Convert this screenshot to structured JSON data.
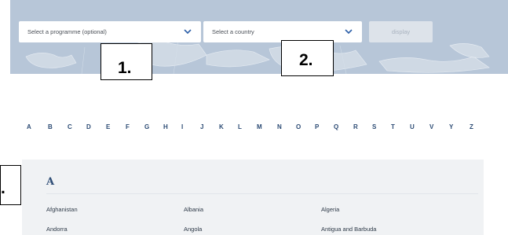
{
  "filters": {
    "programme_placeholder": "Select a programme (optional)",
    "country_placeholder": "Select a country",
    "display_label": "display",
    "chevron_icon": "chevron-down-icon"
  },
  "callouts": [
    "1.",
    "2.",
    "."
  ],
  "alphabet": [
    "A",
    "B",
    "C",
    "D",
    "E",
    "F",
    "G",
    "H",
    "I",
    "J",
    "K",
    "L",
    "M",
    "N",
    "O",
    "P",
    "Q",
    "R",
    "S",
    "T",
    "U",
    "V",
    "Y",
    "Z"
  ],
  "section": {
    "letter": "A",
    "countries": [
      [
        "Afghanistan",
        "Albania",
        "Algeria"
      ],
      [
        "Andorra",
        "Angola",
        "Antigua and Barbuda"
      ]
    ]
  },
  "colors": {
    "banner_bg": "#b7c6d8",
    "accent": "#2c4b74",
    "panel_bg": "#f0f2f4"
  }
}
